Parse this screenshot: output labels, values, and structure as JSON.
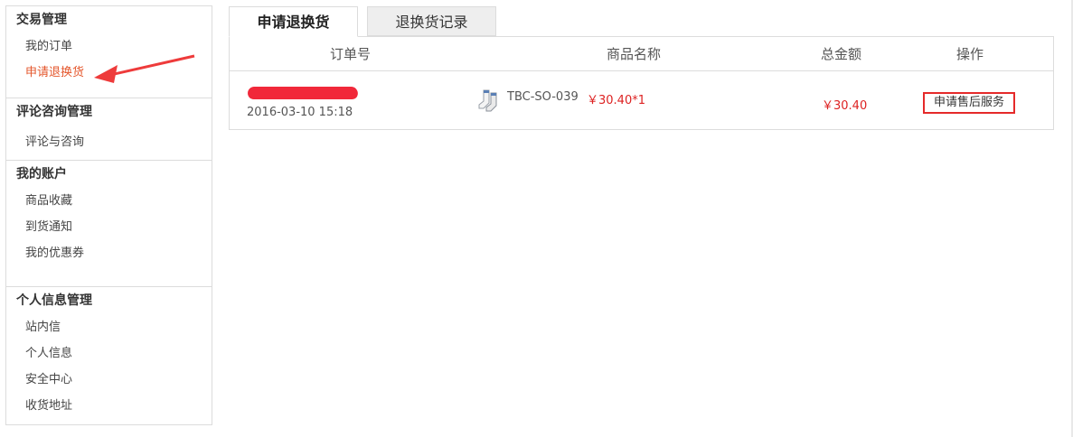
{
  "sidebar": {
    "groups": [
      {
        "title": "交易管理",
        "items": [
          "我的订单",
          "申请退换货"
        ]
      },
      {
        "title": "评论咨询管理",
        "items": [
          "评论与咨询"
        ]
      },
      {
        "title": "我的账户",
        "items": [
          "商品收藏",
          "到货通知",
          "我的优惠券"
        ]
      },
      {
        "title": "个人信息管理",
        "items": [
          "站内信",
          "个人信息",
          "安全中心",
          "收货地址"
        ]
      }
    ],
    "active_item": "申请退换货"
  },
  "tabs": [
    {
      "label": "申请退换货",
      "active": true
    },
    {
      "label": "退换货记录",
      "active": false
    }
  ],
  "table": {
    "headers": [
      "订单号",
      "商品名称",
      "总金额",
      "操作"
    ],
    "rows": [
      {
        "datetime": "2016-03-10 15:18",
        "product_code": "TBC-SO-039",
        "product_price": "￥30.40*1",
        "total": "￥30.40",
        "action": "申请售后服务"
      }
    ]
  },
  "colors": {
    "accent_red": "#e52a2a",
    "active_orange": "#e4562b",
    "border": "#dcdcdc"
  },
  "icons": [
    "product-thumbnail-icon",
    "annotation-arrow"
  ]
}
